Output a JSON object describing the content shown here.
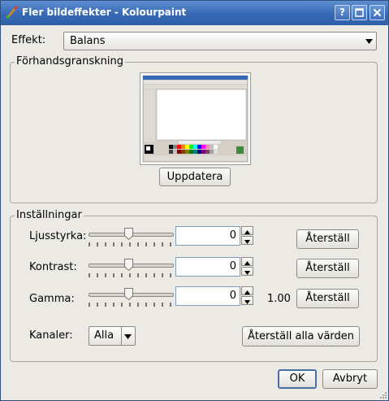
{
  "window": {
    "title": "Fler bildeffekter - Kolourpaint"
  },
  "effect": {
    "label": "Effekt:",
    "value": "Balans"
  },
  "preview": {
    "group_title": "Förhandsgranskning",
    "update_button": "Uppdatera"
  },
  "settings": {
    "group_title": "Inställningar",
    "rows": [
      {
        "label": "Ljusstyrka:",
        "value": "0",
        "extra": "",
        "reset": "Återställ"
      },
      {
        "label": "Kontrast:",
        "value": "0",
        "extra": "",
        "reset": "Återställ"
      },
      {
        "label": "Gamma:",
        "value": "0",
        "extra": "1.00",
        "reset": "Återställ"
      }
    ],
    "channels": {
      "label": "Kanaler:",
      "value": "Alla"
    },
    "reset_all": "Återställ alla värden"
  },
  "buttons": {
    "ok": "OK",
    "cancel": "Avbryt"
  },
  "colors": {
    "titlebar": "#3668b5",
    "dialog_bg": "#eceae5",
    "accent": "#4a7cc9"
  }
}
